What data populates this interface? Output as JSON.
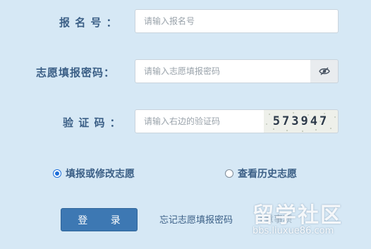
{
  "form": {
    "registration_number": {
      "label": "报 名 号 ：",
      "placeholder": "请输入报名号"
    },
    "password": {
      "label": "志愿填报密码：",
      "placeholder": "请输入志愿填报密码",
      "toggle_icon": "eye-slash-icon"
    },
    "captcha": {
      "label": "验 证 码 ：",
      "placeholder": "请输入右边的验证码",
      "code": "573947"
    }
  },
  "mode_options": [
    {
      "label": "填报或修改志愿",
      "checked": true
    },
    {
      "label": "查看历史志愿",
      "checked": false
    }
  ],
  "actions": {
    "login_label": "登  录",
    "forgot_label": "忘记志愿填报密码"
  },
  "watermark": {
    "title": "留学社区",
    "url": "bbs.liuxue86.com",
    "tail_text": "注意事项"
  },
  "colors": {
    "background": "#d6e8f5",
    "label_text": "#3b5f86",
    "button": "#3d78b3",
    "radio_accent": "#1e6fd9"
  }
}
